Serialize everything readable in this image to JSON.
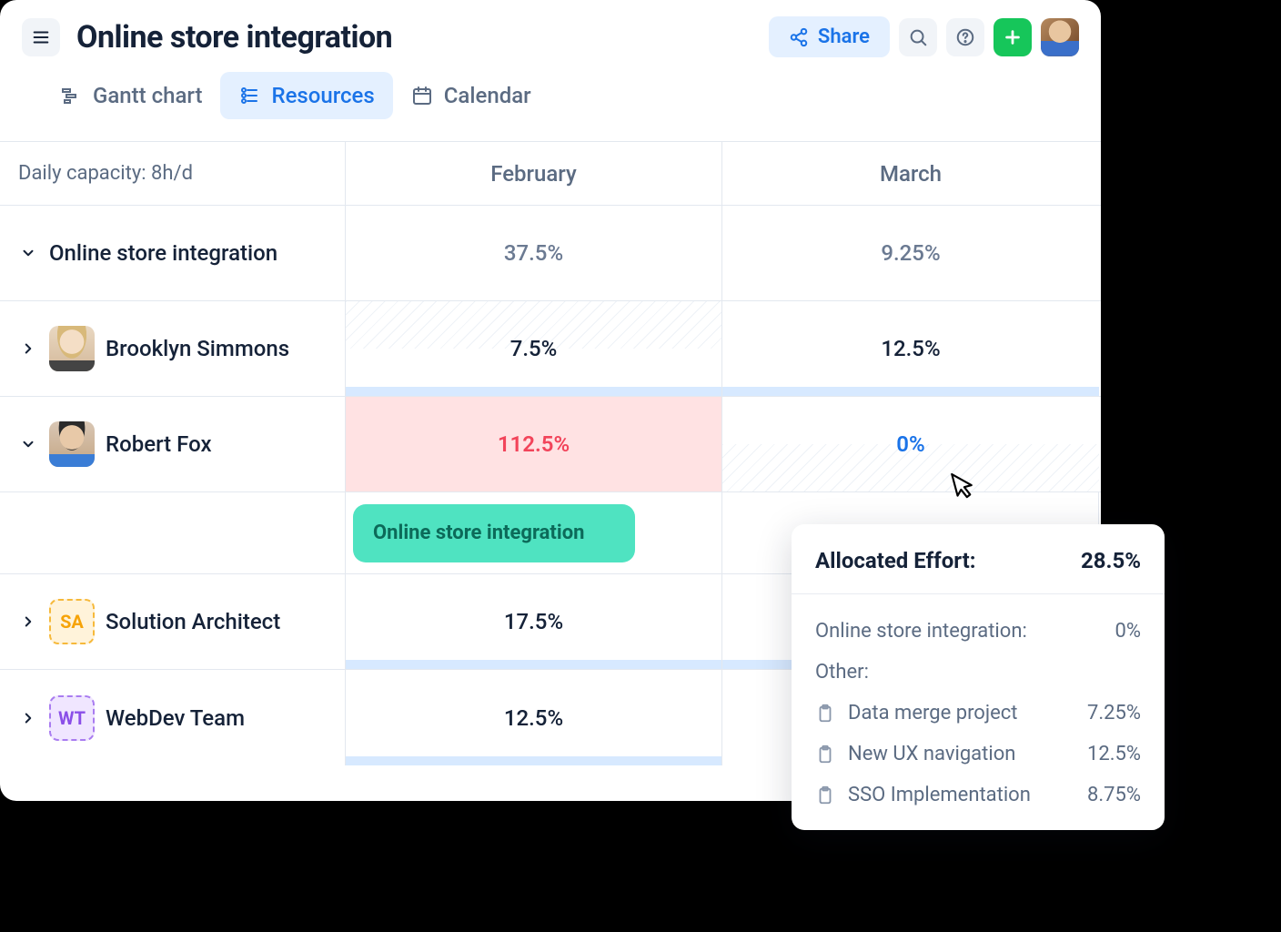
{
  "header": {
    "title": "Online store integration",
    "share_label": "Share"
  },
  "tabs": {
    "gantt": "Gantt chart",
    "resources": "Resources",
    "calendar": "Calendar"
  },
  "table": {
    "capacity_label": "Daily capacity: 8h/d",
    "months": [
      "February",
      "March"
    ],
    "rows": [
      {
        "type": "project",
        "name": "Online store integration",
        "values": [
          "37.5%",
          "9.25%"
        ]
      },
      {
        "type": "person",
        "name": "Brooklyn Simmons",
        "values": [
          "7.5%",
          "12.5%"
        ]
      },
      {
        "type": "person",
        "name": "Robert Fox",
        "values": [
          "112.5%",
          "0%"
        ]
      },
      {
        "type": "bar",
        "label": "Online store integration"
      },
      {
        "type": "role",
        "chip": "SA",
        "name": "Solution Architect",
        "values": [
          "17.5%",
          ""
        ]
      },
      {
        "type": "role",
        "chip": "WT",
        "name": "WebDev Team",
        "values": [
          "12.5%",
          ""
        ]
      }
    ]
  },
  "popover": {
    "title": "Allocated Effort:",
    "total": "28.5%",
    "this_project_label": "Online store integration:",
    "this_project_value": "0%",
    "other_label": "Other:",
    "items": [
      {
        "name": "Data merge project",
        "value": "7.25%"
      },
      {
        "name": "New UX navigation",
        "value": "12.5%"
      },
      {
        "name": "SSO Implementation",
        "value": "8.75%"
      }
    ]
  }
}
